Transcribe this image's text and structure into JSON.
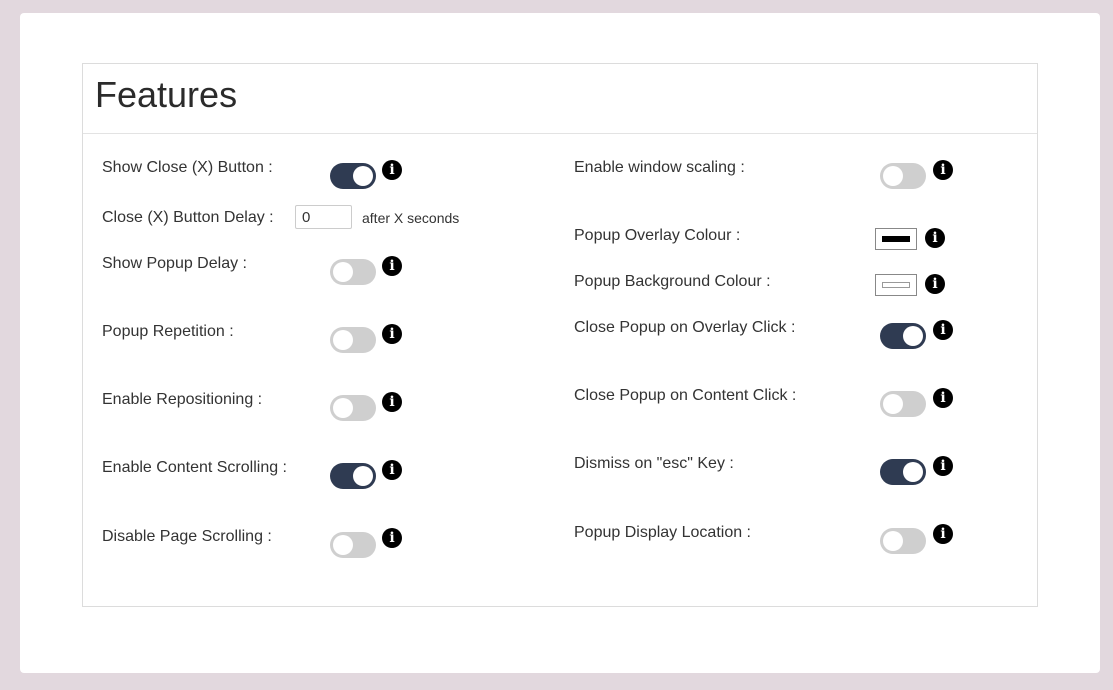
{
  "panel": {
    "title": "Features"
  },
  "left": {
    "show_close_button": {
      "label": "Show Close (X) Button :",
      "enabled": true
    },
    "close_button_delay": {
      "label": "Close (X) Button Delay :",
      "value": "0",
      "suffix": "after X seconds"
    },
    "show_popup_delay": {
      "label": "Show Popup Delay :",
      "enabled": false
    },
    "popup_repetition": {
      "label": "Popup Repetition :",
      "enabled": false
    },
    "enable_repositioning": {
      "label": "Enable Repositioning :",
      "enabled": false
    },
    "enable_content_scrolling": {
      "label": "Enable Content Scrolling :",
      "enabled": true
    },
    "disable_page_scrolling": {
      "label": "Disable Page Scrolling :",
      "enabled": false
    }
  },
  "right": {
    "enable_window_scaling": {
      "label": "Enable window scaling :",
      "enabled": false
    },
    "popup_overlay_colour": {
      "label": "Popup Overlay Colour :",
      "color": "#000000"
    },
    "popup_background_colour": {
      "label": "Popup Background Colour :",
      "color": "#ffffff"
    },
    "close_on_overlay_click": {
      "label": "Close Popup on Overlay Click :",
      "enabled": true
    },
    "close_on_content_click": {
      "label": "Close Popup on Content Click :",
      "enabled": false
    },
    "dismiss_on_esc": {
      "label": "Dismiss on \"esc\" Key :",
      "enabled": true
    },
    "popup_display_location": {
      "label": "Popup Display Location :",
      "enabled": false
    }
  },
  "info_glyph": "i",
  "colors": {
    "toggle_on": "#2f3b52",
    "toggle_off": "#cfcfcf",
    "page_background": "#e2d8de"
  }
}
